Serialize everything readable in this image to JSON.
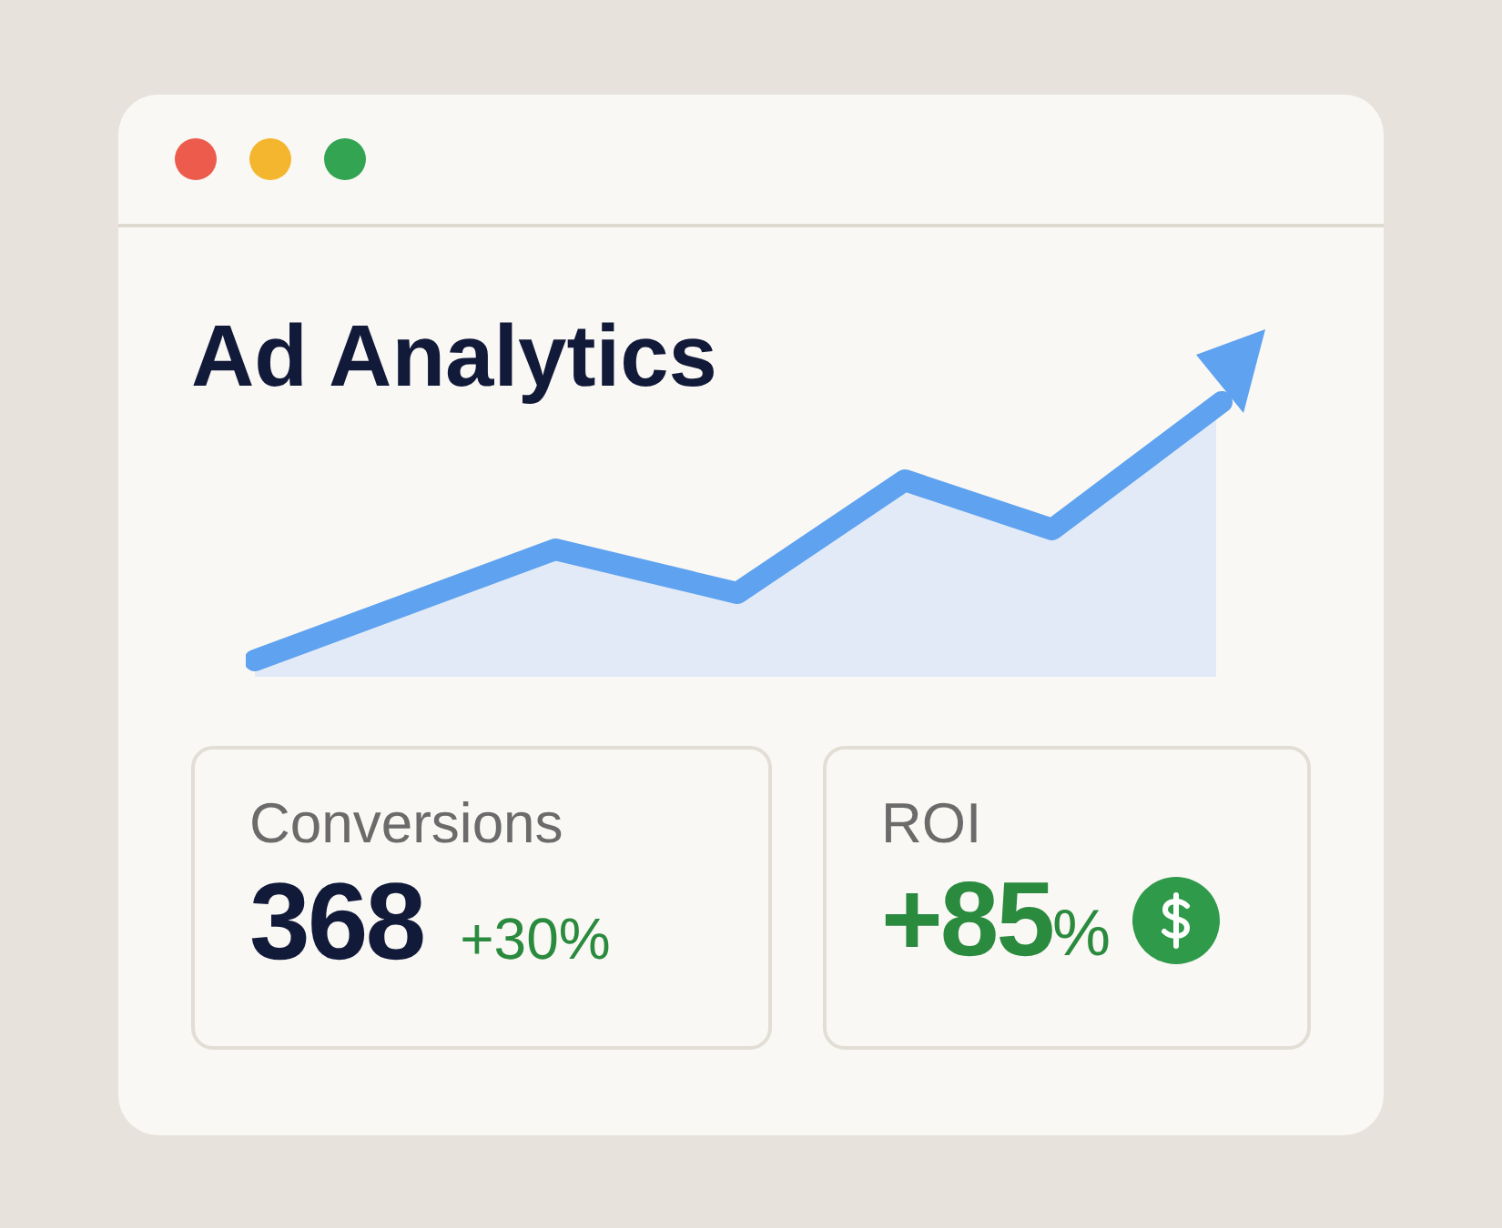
{
  "title": "Ad Analytics",
  "metrics": [
    {
      "kind": "count",
      "label": "Conversions",
      "value": "368",
      "change": "+30%"
    },
    {
      "kind": "percent",
      "label": "ROI",
      "value": "+85",
      "unit": "%"
    }
  ]
}
